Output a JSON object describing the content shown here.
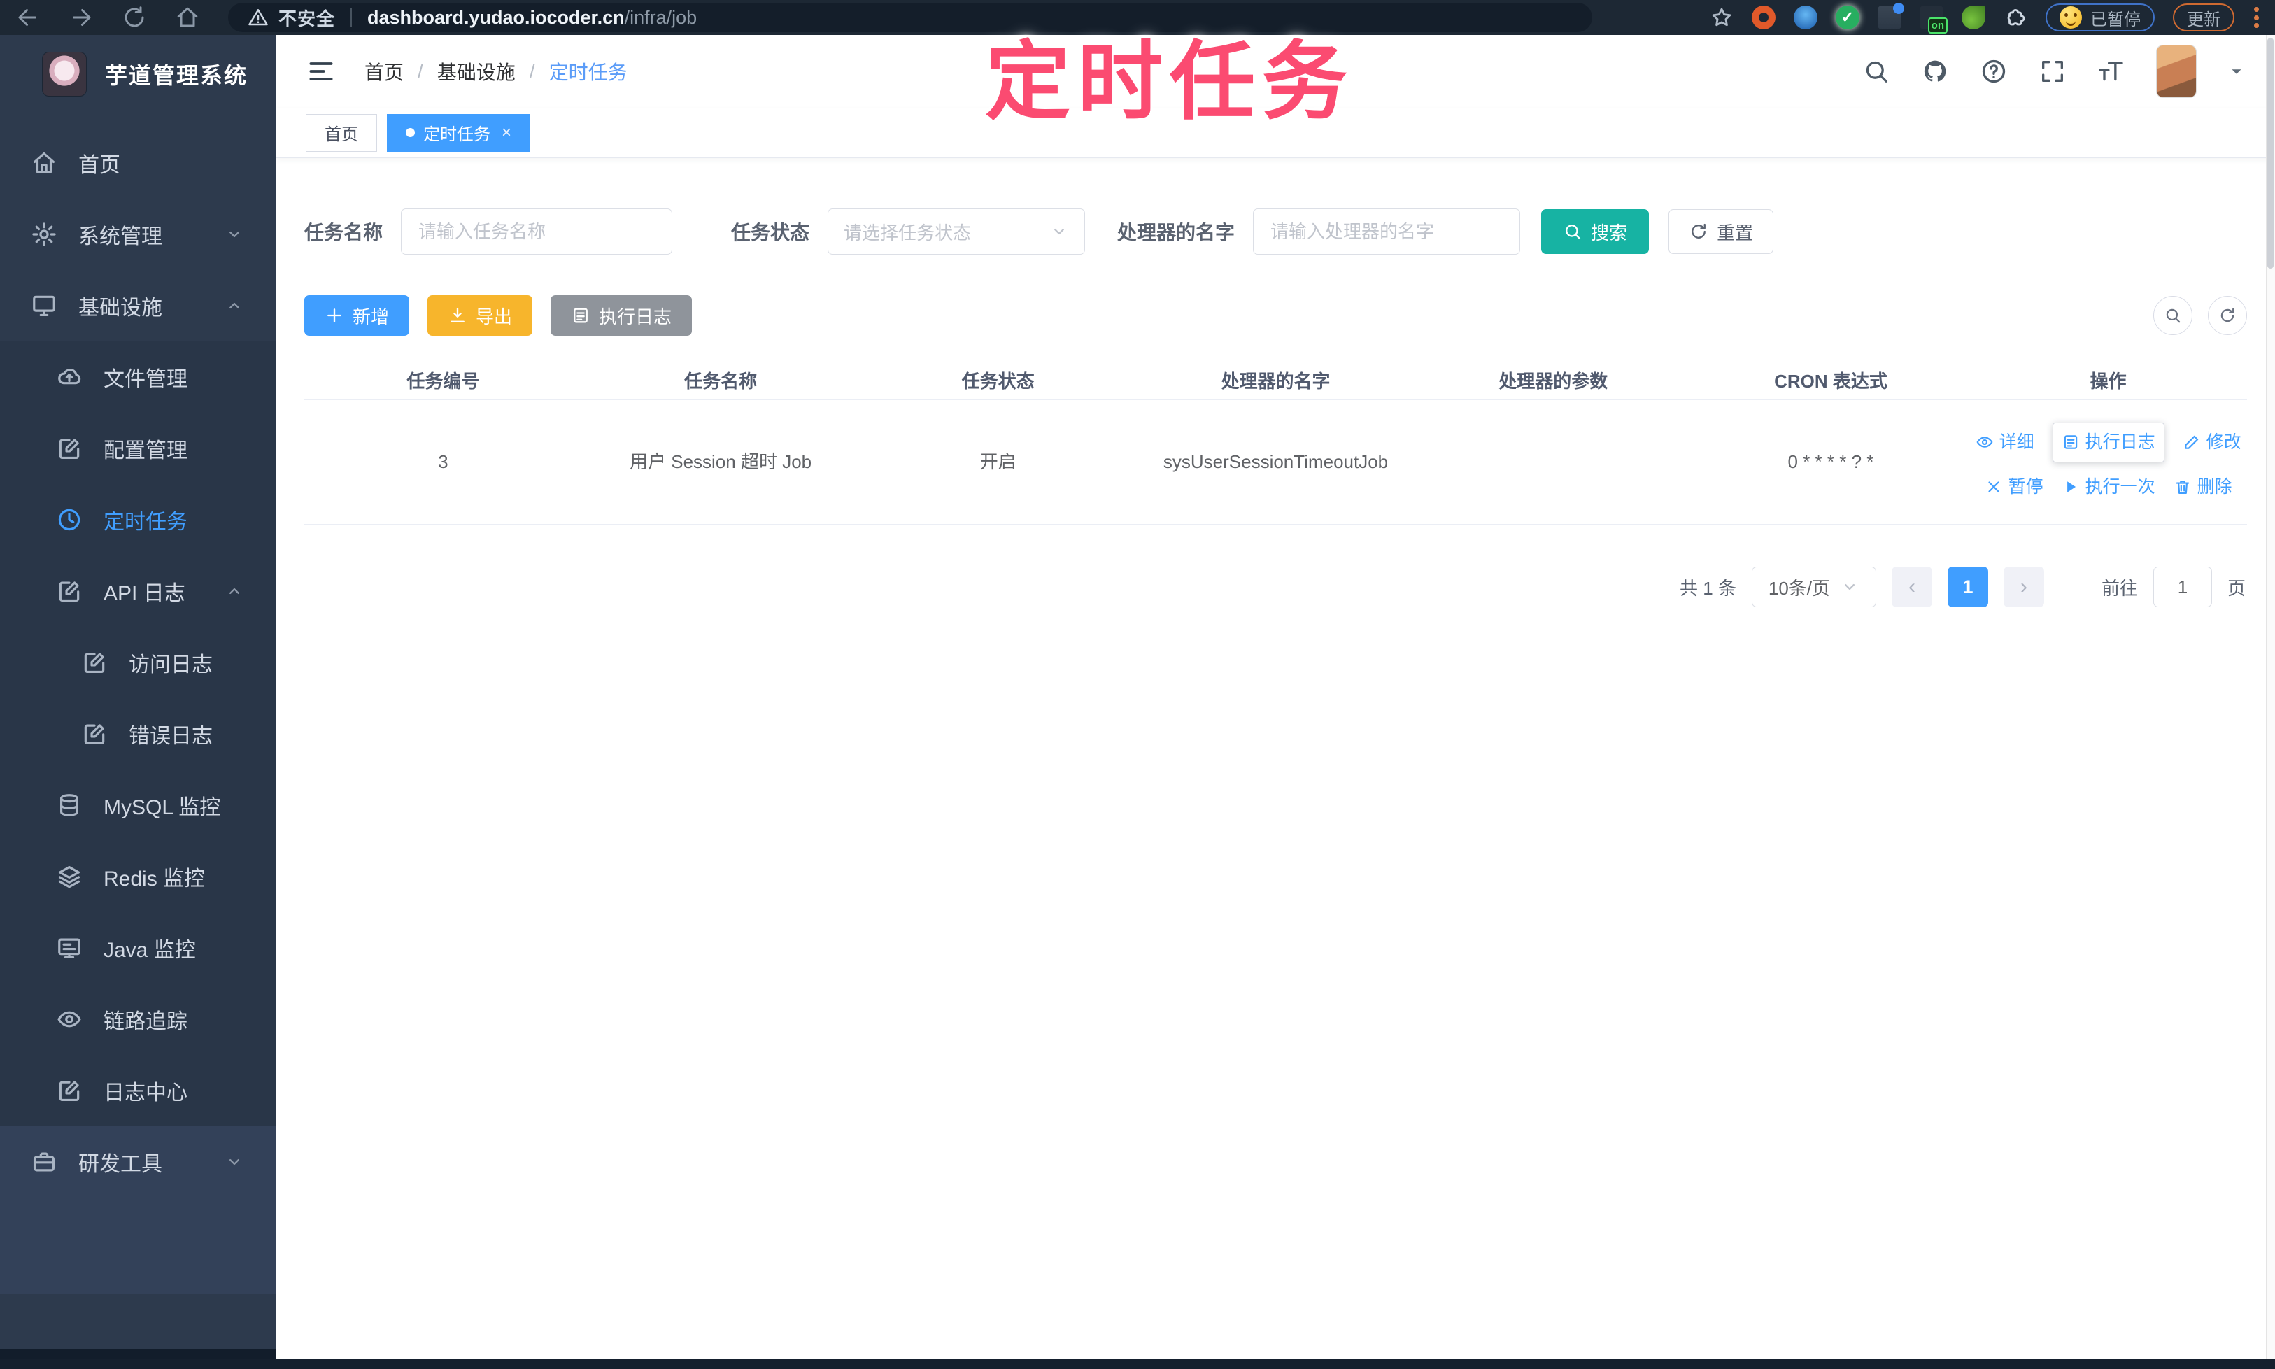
{
  "browser": {
    "security_label": "不安全",
    "url_host": "dashboard.yudao.iocoder.cn",
    "url_path": "/infra/job",
    "paused_badge": "已暂停",
    "update_label": "更新",
    "ext_on_badge": "on"
  },
  "overlay_title": "定时任务",
  "sidebar": {
    "app_title": "芋道管理系统",
    "items": [
      {
        "label": "首页",
        "icon": "home-icon",
        "level": 0
      },
      {
        "label": "系统管理",
        "icon": "gear-icon",
        "level": 0,
        "chevron": "down"
      },
      {
        "label": "基础设施",
        "icon": "monitor-icon",
        "level": 0,
        "chevron": "up"
      },
      {
        "label": "文件管理",
        "icon": "cloud-upload-icon",
        "level": 1
      },
      {
        "label": "配置管理",
        "icon": "edit-square-icon",
        "level": 1
      },
      {
        "label": "定时任务",
        "icon": "clock-icon",
        "level": 1,
        "active": true
      },
      {
        "label": "API 日志",
        "icon": "doc-edit-icon",
        "level": 1,
        "chevron": "up"
      },
      {
        "label": "访问日志",
        "icon": "doc-edit-icon",
        "level": 2
      },
      {
        "label": "错误日志",
        "icon": "doc-edit-icon",
        "level": 2
      },
      {
        "label": "MySQL 监控",
        "icon": "database-icon",
        "level": 1
      },
      {
        "label": "Redis 监控",
        "icon": "layers-icon",
        "level": 1
      },
      {
        "label": "Java 监控",
        "icon": "screen-icon",
        "level": 1
      },
      {
        "label": "链路追踪",
        "icon": "eye-icon",
        "level": 1
      },
      {
        "label": "日志中心",
        "icon": "doc-edit-icon",
        "level": 1
      },
      {
        "label": "研发工具",
        "icon": "briefcase-icon",
        "level": 0,
        "chevron": "down"
      }
    ]
  },
  "navbar": {
    "breadcrumb": [
      "首页",
      "基础设施",
      "定时任务"
    ],
    "separator": "/"
  },
  "tabs": [
    {
      "label": "首页",
      "active": false
    },
    {
      "label": "定时任务",
      "active": true
    }
  ],
  "filters": {
    "name_label": "任务名称",
    "name_placeholder": "请输入任务名称",
    "status_label": "任务状态",
    "status_placeholder": "请选择任务状态",
    "handler_label": "处理器的名字",
    "handler_placeholder": "请输入处理器的名字",
    "search_label": "搜索",
    "reset_label": "重置"
  },
  "toolbar": {
    "add_label": "新增",
    "export_label": "导出",
    "exec_log_label": "执行日志"
  },
  "table": {
    "columns": [
      "任务编号",
      "任务名称",
      "任务状态",
      "处理器的名字",
      "处理器的参数",
      "CRON 表达式",
      "操作"
    ],
    "row": {
      "id": "3",
      "name": "用户 Session 超时 Job",
      "status": "开启",
      "handler": "sysUserSessionTimeoutJob",
      "param": "",
      "cron": "0 * * * * ? *"
    },
    "actions_row1": [
      {
        "label": "详细",
        "icon": "eye-icon"
      },
      {
        "label": "执行日志",
        "icon": "list-icon",
        "highlighted": true
      },
      {
        "label": "修改",
        "icon": "pen-icon"
      }
    ],
    "actions_row2": [
      {
        "label": "暂停",
        "icon": "close-icon"
      },
      {
        "label": "执行一次",
        "icon": "play-icon"
      },
      {
        "label": "删除",
        "icon": "trash-icon"
      }
    ]
  },
  "pagination": {
    "total_label": "共 1 条",
    "page_size": "10条/页",
    "current_page": "1",
    "goto_label": "前往",
    "goto_value": "1",
    "page_unit": "页"
  },
  "colors": {
    "primary": "#409eff",
    "search_button": "#17b3a3",
    "export_button": "#f7b52c",
    "info_button": "#8f949b",
    "overlay_pink": "#fb4b71",
    "sidebar_bg": "#2d3a4d",
    "browser_bar_bg": "#1d2834"
  },
  "icons": {
    "search": "magnifier",
    "reset": "circular-arrow",
    "add": "plus",
    "export": "download-arrow",
    "exec_log": "list-lines",
    "github": "octocat",
    "help": "question-circle",
    "fullscreen": "corner-arrows",
    "font_size": "double-T",
    "warning": "triangle-exclamation"
  }
}
